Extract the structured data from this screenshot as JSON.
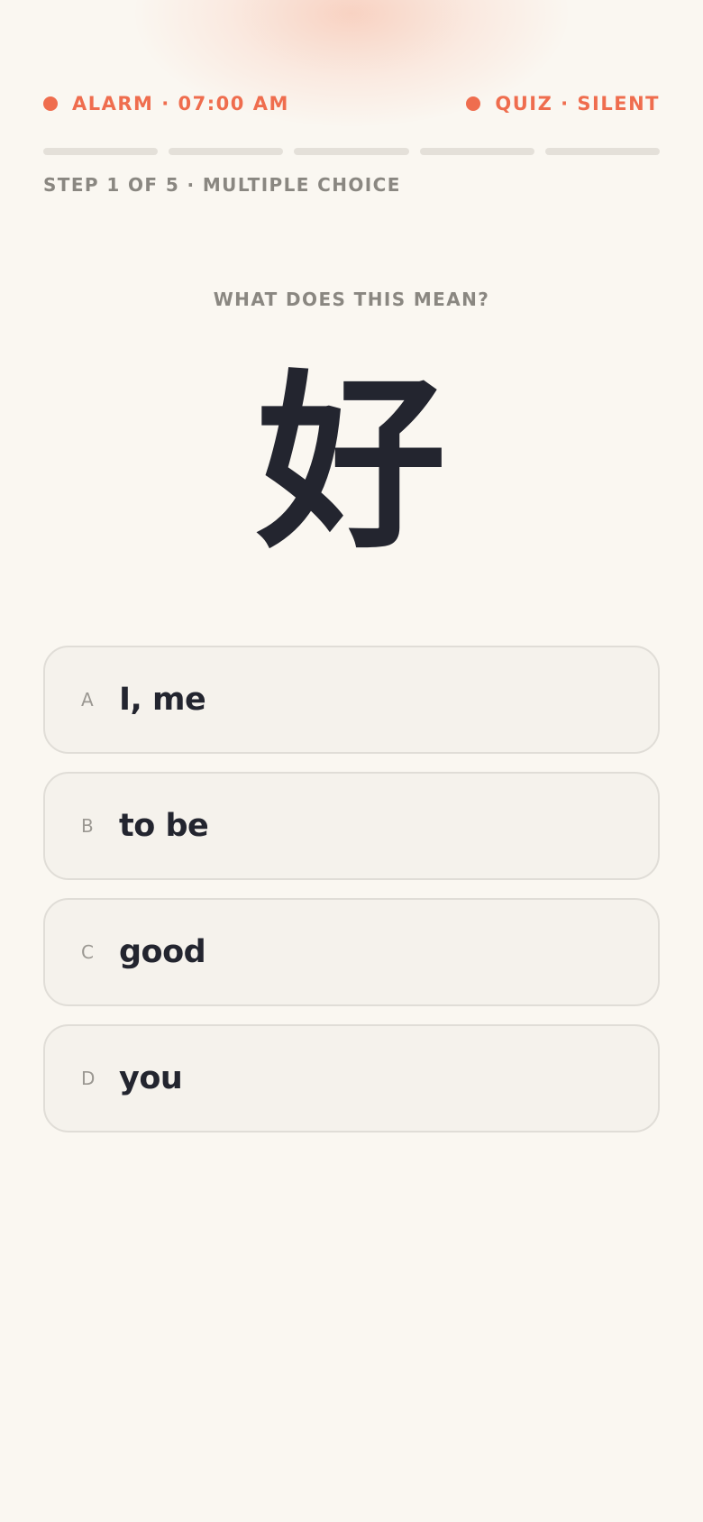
{
  "header": {
    "alarm_label": "ALARM · 07:00 AM",
    "mode_label": "QUIZ · SILENT",
    "accent_color": "#ef6d4e"
  },
  "progress": {
    "current_step": 1,
    "total_steps": 5,
    "step_label": "STEP 1 OF 5 · MULTIPLE CHOICE"
  },
  "question": {
    "prompt": "WHAT DOES THIS MEAN?",
    "character": "好"
  },
  "options": [
    {
      "letter": "A",
      "text": "I, me"
    },
    {
      "letter": "B",
      "text": "to be"
    },
    {
      "letter": "C",
      "text": "good"
    },
    {
      "letter": "D",
      "text": "you"
    }
  ]
}
